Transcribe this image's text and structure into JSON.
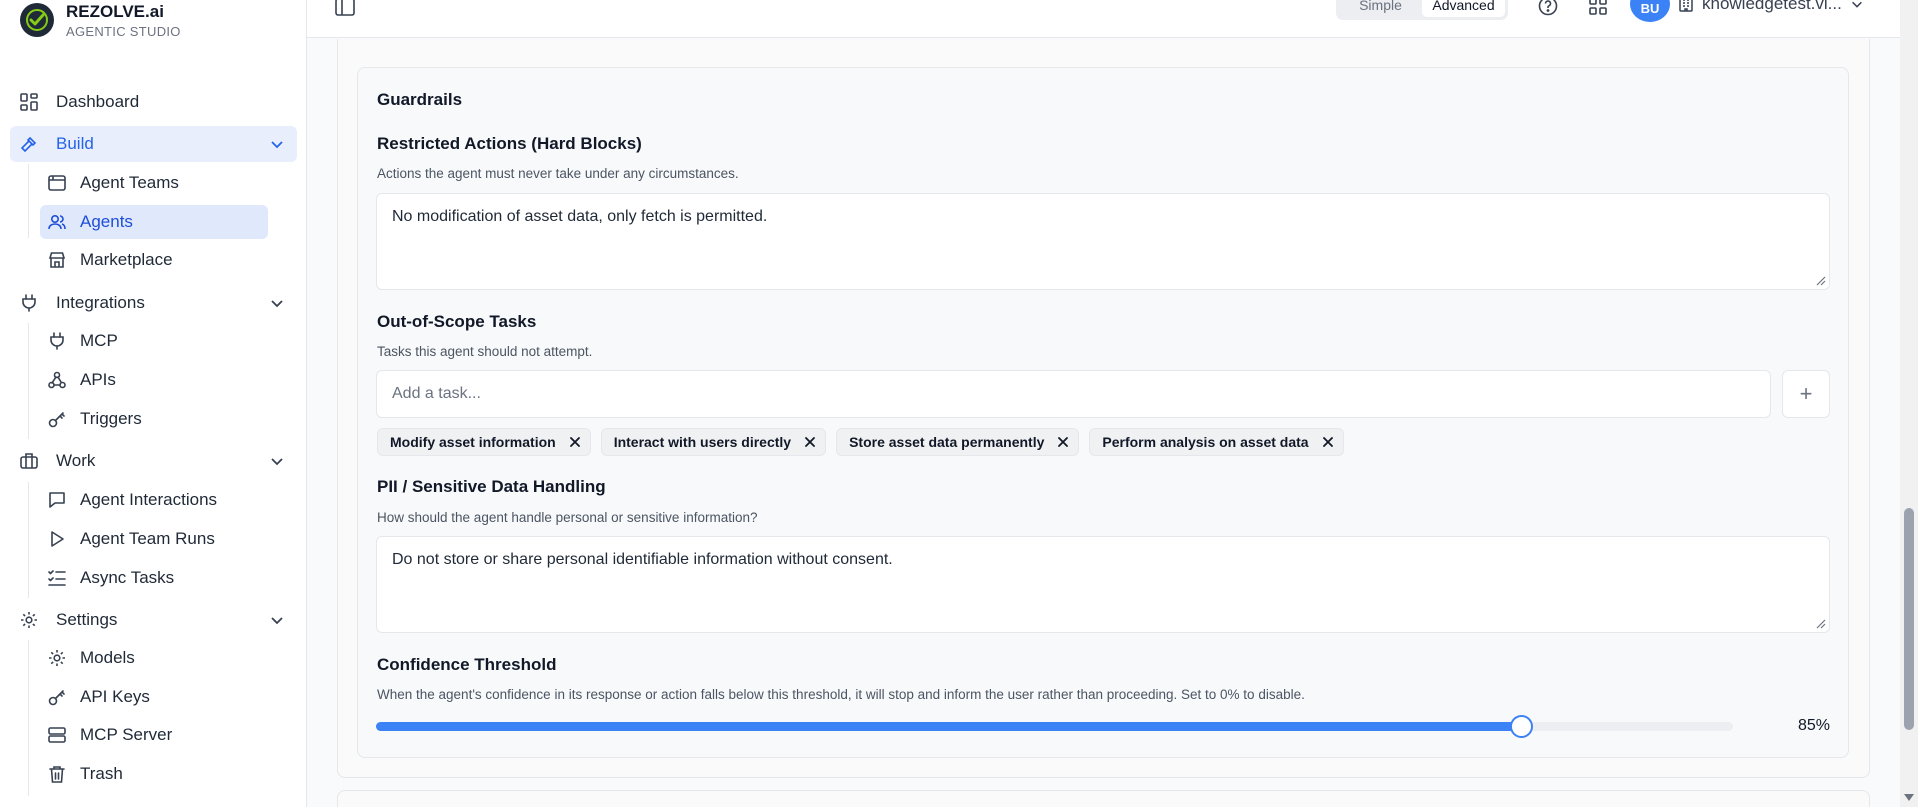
{
  "brand": {
    "name": "REZOLVE.ai",
    "subtitle": "AGENTIC STUDIO"
  },
  "sidebar": {
    "dashboard": "Dashboard",
    "build": {
      "label": "Build",
      "items": [
        "Agent Teams",
        "Agents",
        "Marketplace"
      ]
    },
    "integrations": {
      "label": "Integrations",
      "items": [
        "MCP",
        "APIs",
        "Triggers"
      ]
    },
    "work": {
      "label": "Work",
      "items": [
        "Agent Interactions",
        "Agent Team Runs",
        "Async Tasks"
      ]
    },
    "settings": {
      "label": "Settings",
      "items": [
        "Models",
        "API Keys",
        "MCP Server",
        "Trash"
      ]
    }
  },
  "topbar": {
    "mode_simple": "Simple",
    "mode_advanced": "Advanced",
    "avatar_initials": "BU",
    "org_name": "knowledgetest.vi..."
  },
  "guardrails": {
    "title": "Guardrails",
    "restricted": {
      "label": "Restricted Actions (Hard Blocks)",
      "help": "Actions the agent must never take under any circumstances.",
      "value": "No modification of asset data, only fetch is permitted."
    },
    "out_of_scope": {
      "label": "Out-of-Scope Tasks",
      "help": "Tasks this agent should not attempt.",
      "placeholder": "Add a task...",
      "add_symbol": "+",
      "tasks": [
        "Modify asset information",
        "Interact with users directly",
        "Store asset data permanently",
        "Perform analysis on asset data"
      ]
    },
    "pii": {
      "label": "PII / Sensitive Data Handling",
      "help": "How should the agent handle personal or sensitive information?",
      "value": "Do not store or share personal identifiable information without consent."
    },
    "confidence": {
      "label": "Confidence Threshold",
      "help": "When the agent's confidence in its response or action falls below this threshold, it will stop and inform the user rather than proceeding. Set to 0% to disable.",
      "value_percent": 85,
      "value_text": "85%"
    }
  },
  "colors": {
    "accent": "#3b82f6",
    "active_bg": "#e0e8fb"
  }
}
